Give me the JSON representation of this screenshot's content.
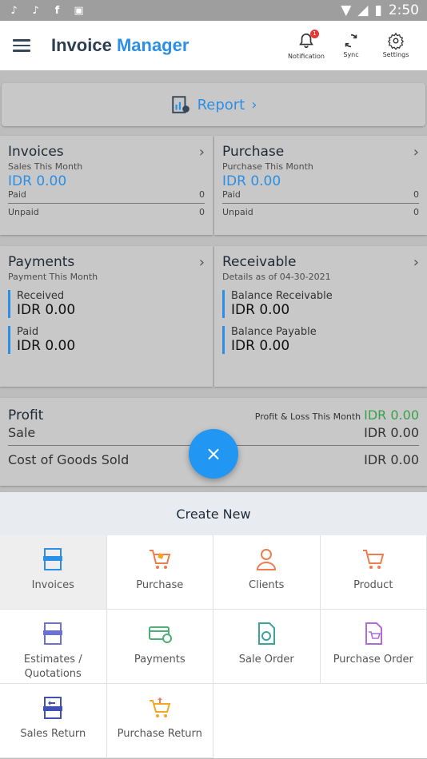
{
  "status_bar": {
    "time": "2:50",
    "icons": [
      "tiktok-icon",
      "tiktok-icon",
      "facebook-icon",
      "app-icon",
      "wifi-icon",
      "signal-icon",
      "battery-icon"
    ]
  },
  "app_bar": {
    "title_part1": "Invoice",
    "title_part2": "Manager",
    "actions": {
      "notification": "Notification",
      "sync": "Sync",
      "settings": "Settings"
    },
    "notification_count": "1"
  },
  "report": {
    "label": "Report"
  },
  "invoices": {
    "title": "Invoices",
    "subtitle": "Sales This Month",
    "amount": "IDR 0.00",
    "paid_label": "Paid",
    "paid_value": "0",
    "unpaid_label": "Unpaid",
    "unpaid_value": "0"
  },
  "purchase": {
    "title": "Purchase",
    "subtitle": "Purchase This Month",
    "amount": "IDR 0.00",
    "paid_label": "Paid",
    "paid_value": "0",
    "unpaid_label": "Unpaid",
    "unpaid_value": "0"
  },
  "payments": {
    "title": "Payments",
    "subtitle": "Payment This Month",
    "received_label": "Received",
    "received_value": "IDR 0.00",
    "paid_label": "Paid",
    "paid_value": "IDR 0.00"
  },
  "receivable": {
    "title": "Receivable",
    "subtitle": "Details as of 04-30-2021",
    "balance_receivable_label": "Balance Receivable",
    "balance_receivable_value": "IDR 0.00",
    "balance_payable_label": "Balance Payable",
    "balance_payable_value": "IDR 0.00"
  },
  "profit": {
    "title": "Profit",
    "pl_label": "Profit & Loss This Month",
    "pl_value": "IDR 0.00",
    "sale_label": "Sale",
    "sale_value": "IDR 0.00",
    "cogs_label": "Cost of Goods Sold",
    "cogs_value": "IDR 0.00"
  },
  "fab": {
    "symbol": "×"
  },
  "create_new": {
    "title": "Create New",
    "items": [
      {
        "label": "Invoices"
      },
      {
        "label": "Purchase"
      },
      {
        "label": "Clients"
      },
      {
        "label": "Product"
      },
      {
        "label": "Estimates / Quotations"
      },
      {
        "label": "Payments"
      },
      {
        "label": "Sale Order"
      },
      {
        "label": "Purchase Order"
      },
      {
        "label": "Sales Return"
      },
      {
        "label": "Purchase Return"
      }
    ]
  },
  "colors": {
    "accent": "#2b8fe6",
    "green": "#39a04a",
    "fab": "#2196f3"
  }
}
